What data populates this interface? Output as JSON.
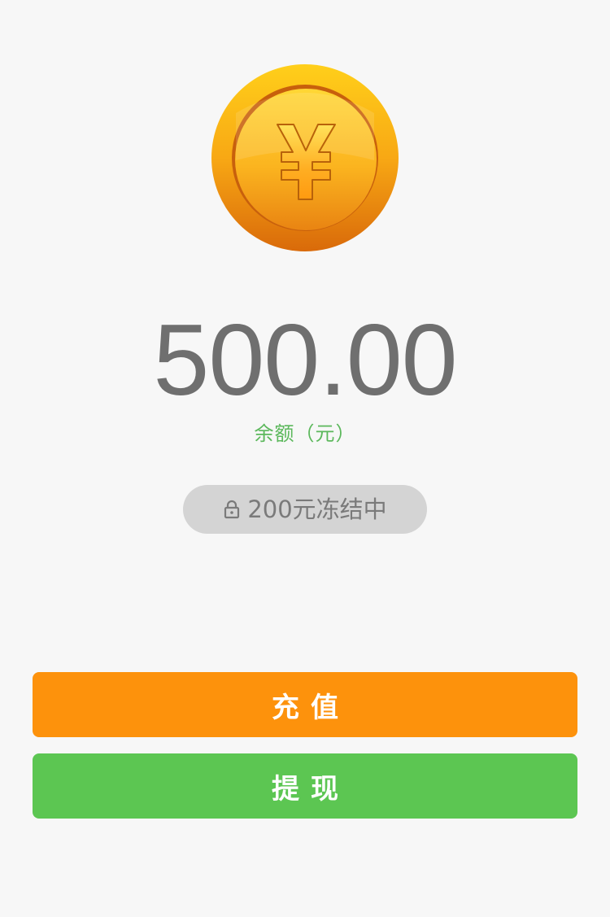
{
  "wallet": {
    "balance": "500.00",
    "balance_label": "余额（元）",
    "frozen_text": "200元冻结中",
    "coin_icon": "yuan-coin-icon",
    "lock_icon": "lock-icon"
  },
  "actions": {
    "recharge_label": "充值",
    "withdraw_label": "提现"
  },
  "colors": {
    "background": "#f7f7f7",
    "recharge_button": "#fd920c",
    "withdraw_button": "#5cc652",
    "balance_label": "#5cb85c",
    "balance_text": "#6f6f6f",
    "frozen_pill": "#d4d4d4"
  }
}
